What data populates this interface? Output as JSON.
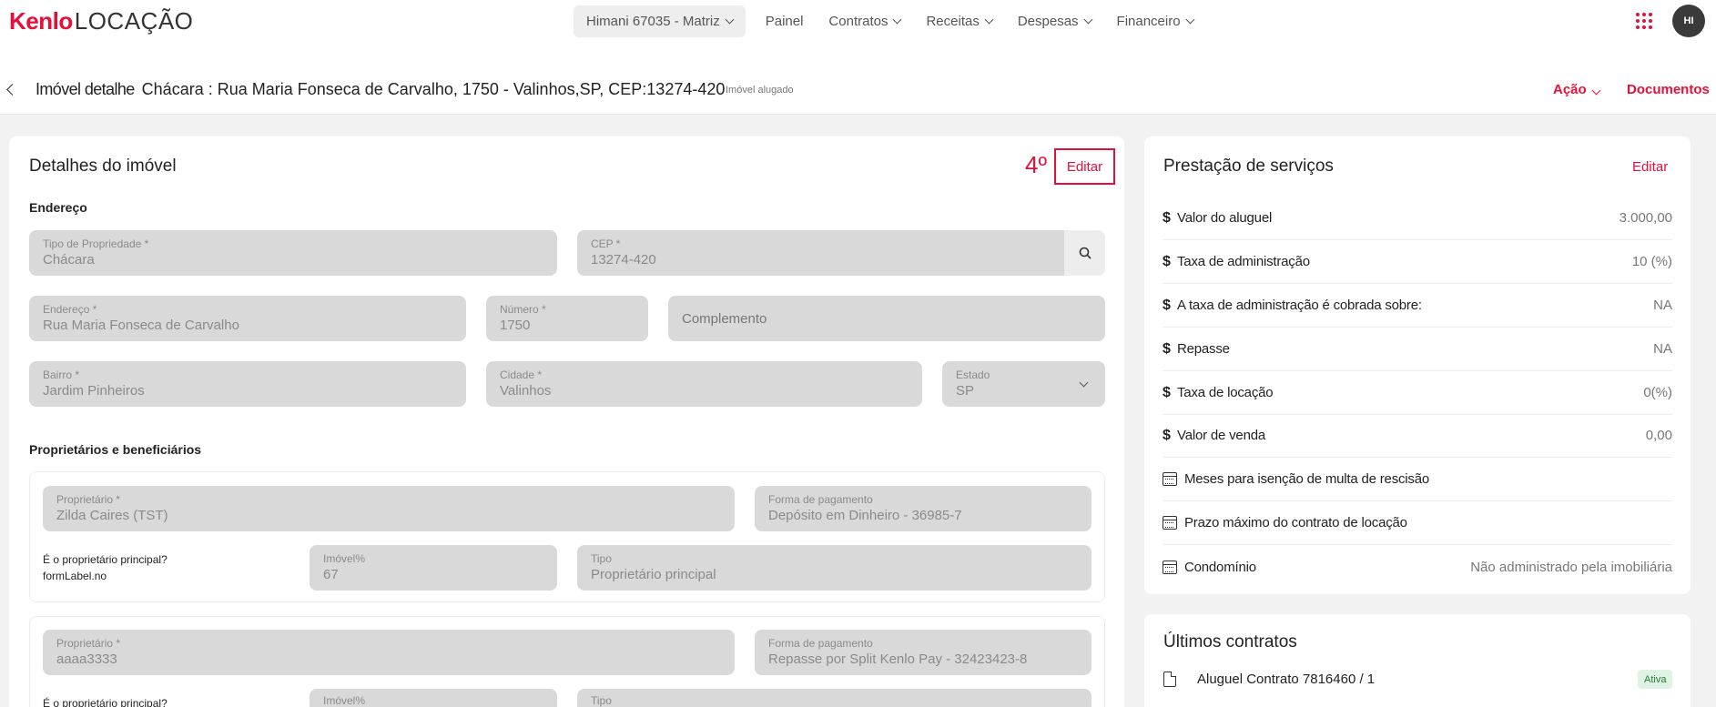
{
  "brand": {
    "logo_kenlo": "Kenlo",
    "logo_product": "LOCAÇÃO",
    "accent_color": "#e5103a"
  },
  "nav": {
    "branch": "Himani 67035 - Matriz",
    "items": [
      "Painel",
      "Contratos",
      "Receitas",
      "Despesas",
      "Financeiro"
    ],
    "avatar_initials": "HI",
    "apps_icon": "grid-dots-icon"
  },
  "header": {
    "label": "Imóvel detalhe",
    "address": "Chácara : Rua Maria Fonseca de Carvalho, 1750 - Valinhos,SP, CEP:13274-420",
    "status": "Imóvel alugado",
    "action_label": "Ação",
    "documents_label": "Documentos"
  },
  "details": {
    "title": "Detalhes do imóvel",
    "annotation": "4º",
    "edit_label": "Editar",
    "address_section": "Endereço",
    "fields": {
      "tipo": {
        "label": "Tipo de Propriedade *",
        "value": "Chácara"
      },
      "cep": {
        "label": "CEP *",
        "value": "13274-420"
      },
      "endereco": {
        "label": "Endereço *",
        "value": "Rua Maria Fonseca de Carvalho"
      },
      "numero": {
        "label": "Número *",
        "value": "1750"
      },
      "complemento": {
        "placeholder": "Complemento"
      },
      "bairro": {
        "label": "Bairro *",
        "value": "Jardim Pinheiros"
      },
      "cidade": {
        "label": "Cidade *",
        "value": "Valinhos"
      },
      "estado": {
        "label": "Estado",
        "value": "SP"
      }
    },
    "owners_section": "Proprietários e beneficiários",
    "owners": [
      {
        "owner_label": "Proprietário *",
        "owner_value": "Zilda Caires (TST)",
        "payment_label": "Forma de pagamento",
        "payment_value": "Depósito em Dinheiro - 36985-7",
        "main_question": "É o proprietário principal?",
        "main_value": "formLabel.no",
        "share_label": "Imóvel%",
        "share_value": "67",
        "type_label": "Tipo",
        "type_value": "Proprietário principal"
      },
      {
        "owner_label": "Proprietário *",
        "owner_value": "aaaa3333",
        "payment_label": "Forma de pagamento",
        "payment_value": "Repasse por Split Kenlo Pay - 32423423-8",
        "main_question": "É o proprietário principal?",
        "share_label": "Imóvel%",
        "type_label": "Tipo"
      }
    ]
  },
  "services": {
    "title": "Prestação de serviços",
    "edit_label": "Editar",
    "rows": [
      {
        "icon": "dollar-icon",
        "label": "Valor do aluguel",
        "value": "3.000,00"
      },
      {
        "icon": "dollar-icon",
        "label": "Taxa de administração",
        "value": "10 (%)"
      },
      {
        "icon": "dollar-icon",
        "label": "A taxa de administração é cobrada sobre:",
        "value": "NA"
      },
      {
        "icon": "dollar-icon",
        "label": "Repasse",
        "value": "NA"
      },
      {
        "icon": "dollar-icon",
        "label": "Taxa de locação",
        "value": "0(%)"
      },
      {
        "icon": "dollar-icon",
        "label": "Valor de venda",
        "value": "0,00"
      },
      {
        "icon": "calendar-icon",
        "label": "Meses para isenção de multa de rescisão",
        "value": ""
      },
      {
        "icon": "calendar-icon",
        "label": "Prazo máximo do contrato de locação",
        "value": ""
      },
      {
        "icon": "calendar-icon",
        "label": "Condomínio",
        "value": "Não administrado pela imobiliária"
      }
    ]
  },
  "contracts": {
    "title": "Últimos contratos",
    "items": [
      {
        "label": "Aluguel Contrato 7816460 / 1",
        "status": "Ativa"
      }
    ]
  }
}
